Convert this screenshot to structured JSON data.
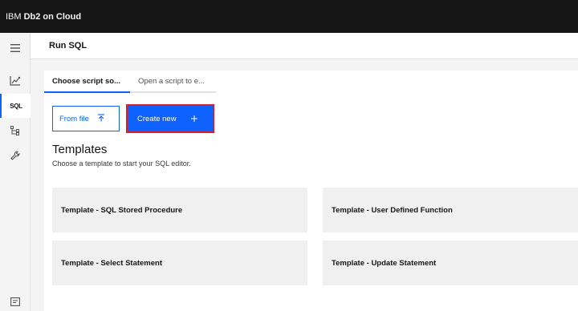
{
  "app": {
    "brand_light": "IBM",
    "brand_bold": "Db2 on Cloud"
  },
  "sidebar": {
    "items": [
      {
        "icon": "hamburger-menu-icon"
      },
      {
        "icon": "chart-icon"
      },
      {
        "label": "SQL",
        "active": true
      },
      {
        "icon": "tree-diagram-icon"
      },
      {
        "icon": "wrench-icon"
      },
      {
        "icon": "terminal-icon"
      }
    ]
  },
  "page": {
    "title": "Run SQL"
  },
  "tabs": [
    {
      "label": "Choose script so...",
      "active": true
    },
    {
      "label": "Open a script to e...",
      "active": false
    }
  ],
  "buttons": {
    "from_file": "From file",
    "create_new": "Create new"
  },
  "templates": {
    "title": "Templates",
    "subtitle": "Choose a template to start your SQL editor.",
    "cards": [
      "Template - SQL Stored Procedure",
      "Template - User Defined Function",
      "Template - Select Statement",
      "Template - Update Statement"
    ]
  },
  "colors": {
    "accent": "#0f62fe",
    "highlight": "#da1e28",
    "topbar": "#161616"
  }
}
